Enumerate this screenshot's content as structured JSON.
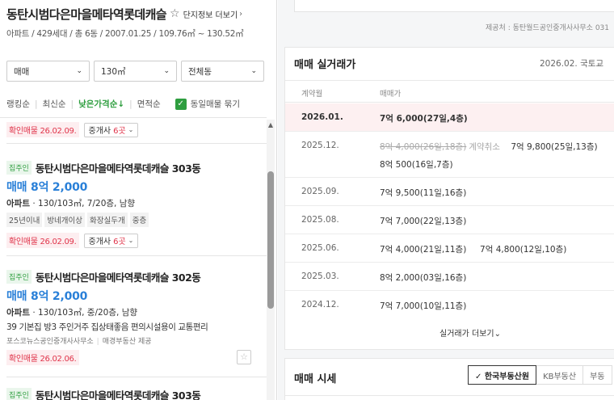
{
  "complex": {
    "title": "동탄시범다은마을메타역롯데캐슬",
    "info_link": "단지정보 더보기",
    "subinfo": "아파트 / 429세대 / 총 6동 / 2007.01.25 / 109.76㎡ ~ 130.52㎡"
  },
  "filters": [
    {
      "value": "매매"
    },
    {
      "value": "130㎡"
    },
    {
      "value": "전체동"
    }
  ],
  "sort": {
    "options": [
      "랭킹순",
      "최신순",
      "낮은가격순↓",
      "면적순"
    ],
    "active_index": 2,
    "checkbox_label": "동일매물 묶기",
    "checkbox_checked": true
  },
  "listings": [
    {
      "verified": "확인매물 26.02.09.",
      "agent_label": "중개사",
      "agent_count": "6곳"
    },
    {
      "owner_badge": "집주인",
      "name": "동탄시범다은마을메타역롯데캐슬 303동",
      "price": "매매 8억 2,000",
      "type": "아파트",
      "spec": "130/103㎡, 7/20층, 남향",
      "tags": [
        "25년이내",
        "방네개이상",
        "화장실두개",
        "중층"
      ],
      "verified": "확인매물 26.02.09.",
      "agent_label": "중개사",
      "agent_count": "6곳"
    },
    {
      "owner_badge": "집주인",
      "name": "동탄시범다은마을메타역롯데캐슬 302동",
      "price": "매매 8억 2,000",
      "type": "아파트",
      "spec": "130/103㎡, 중/20층, 남향",
      "desc": "39 기본집 방3 주인거주 집상태좋음 편의시설용이 교통편리",
      "source_1": "포스코뉴스공인중개사사무소",
      "source_2": "매경부동산 제공",
      "verified": "확인매물 26.02.06."
    },
    {
      "owner_badge": "집주인",
      "name": "동탄시범다은마을메타역롯데캐슬 303동"
    }
  ],
  "right": {
    "provider": "제공처 : 동탄월드공인중개사사무소 031",
    "transactions": {
      "title": "매매 실거래가",
      "date": "2026.02. 국토교",
      "col_date": "계약월",
      "col_price": "매매가",
      "rows": [
        {
          "date": "2026.01.",
          "price": "7억 6,000(27일,4층)",
          "highlight": true
        },
        {
          "date": "2025.12.",
          "cancelled": "8억 4,000(26일,18층)",
          "cancel_label": "계약취소",
          "price_b": "7억 9,800(25일,13층)",
          "price_c": "8억 500(16일,7층)"
        },
        {
          "date": "2025.09.",
          "price": "7억 9,500(11일,16층)"
        },
        {
          "date": "2025.08.",
          "price": "7억 7,000(22일,13층)"
        },
        {
          "date": "2025.06.",
          "price": "7억 4,000(21일,11층)",
          "price_b": "7억 4,800(12일,10층)"
        },
        {
          "date": "2025.03.",
          "price": "8억 2,000(03일,16층)"
        },
        {
          "date": "2024.12.",
          "price": "7억 7,000(10일,11층)"
        }
      ],
      "more": "실거래가 더보기"
    },
    "market": {
      "title": "매매 시세",
      "tabs": [
        "✓ 한국부동산원",
        "KB부동산",
        "부동"
      ]
    }
  }
}
